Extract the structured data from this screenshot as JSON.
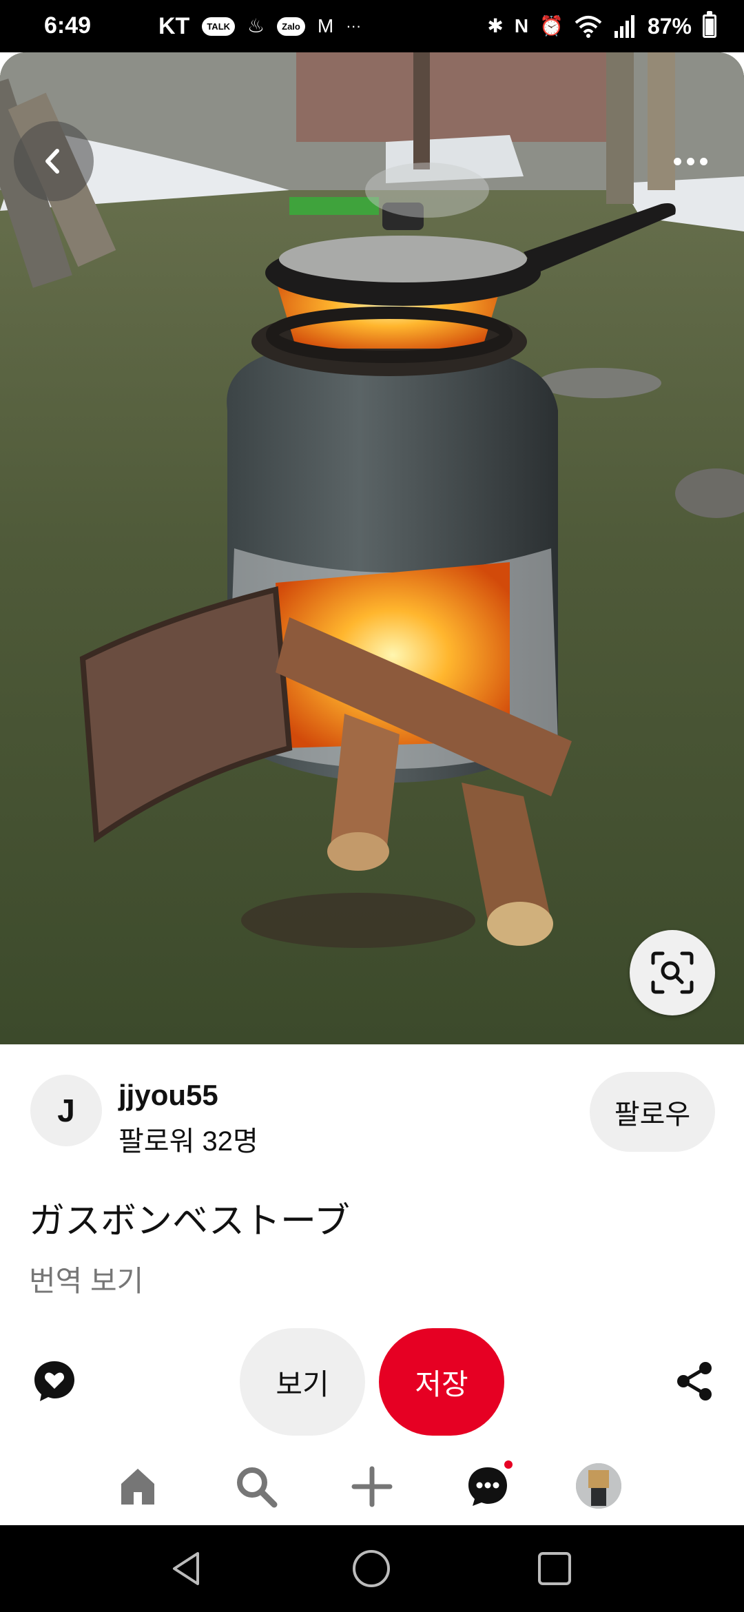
{
  "status_bar": {
    "time": "6:49",
    "carrier": "KT",
    "talk_badge": "TALK",
    "zalo_badge": "Zalo",
    "more_notifications": "···",
    "battery": "87%",
    "battery_level": 0.87
  },
  "pin": {
    "image_description": "cast-iron pan on a wood stove made from a gas cylinder",
    "creator": {
      "avatar_initial": "J",
      "name": "jjyou55",
      "followers": "팔로워 32명",
      "follow_label": "팔로우"
    },
    "title": "ガスボンベストーブ",
    "translate_label": "번역 보기"
  },
  "actions": {
    "view_label": "보기",
    "save_label": "저장",
    "save_color": "#e60023"
  },
  "tabs": [
    "home-icon",
    "search-icon",
    "plus-icon",
    "chat-icon",
    "profile-avatar"
  ],
  "icons": {
    "back": "chevron-left-icon",
    "more": "more-horizontal-icon",
    "lens": "visual-search-icon",
    "heart": "heart-comment-icon",
    "share": "share-icon"
  }
}
